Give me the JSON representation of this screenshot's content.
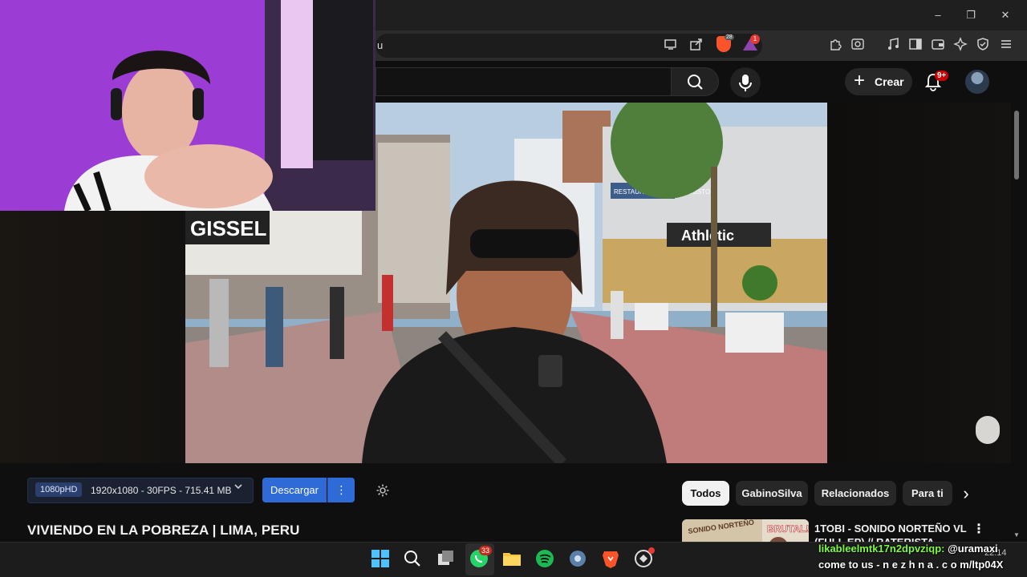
{
  "browser": {
    "url_text": "u",
    "window_controls": {
      "minimize": "–",
      "maximize": "❐",
      "close": "✕"
    },
    "brave_badge": "28",
    "rewards_badge": "1"
  },
  "header": {
    "create_label": "Crear",
    "notifications_badge": "9+"
  },
  "player": {
    "quality_badge": "1080pHD",
    "quality_text": "1920x1080 - 30FPS - 715.41 MB",
    "download_label": "Descargar",
    "download_more": "⋮"
  },
  "video": {
    "title": "VIVIENDO EN LA POBREZA | LIMA, PERU",
    "signs": {
      "store": "GISSEL",
      "brand": "Athletic",
      "restaurant": "RESTAURANT EL BUEN GUSTO"
    }
  },
  "chips": [
    {
      "label": "Todos",
      "active": true
    },
    {
      "label": "GabinoSilva",
      "active": false
    },
    {
      "label": "Relacionados",
      "active": false
    },
    {
      "label": "Para ti",
      "active": false
    }
  ],
  "recommendation": {
    "title_line1": "1TOBI - SONIDO NORTEÑO VL.2",
    "title_line2": "(FULL EP) // RATERISTA",
    "thumb_text_left": "SONIDO NORTEÑO",
    "thumb_text_right": "BRUTAL!!"
  },
  "taskbar": {
    "whatsapp_badge": "33"
  },
  "overlay": {
    "line1_user": "likableelmtk17n2dpvziqp:",
    "line1_msg": "@uramaxi",
    "line2": "come to us - n e z h n a . c o m/ltp04X"
  },
  "clock": {
    "time": "22:14",
    "date": ""
  }
}
